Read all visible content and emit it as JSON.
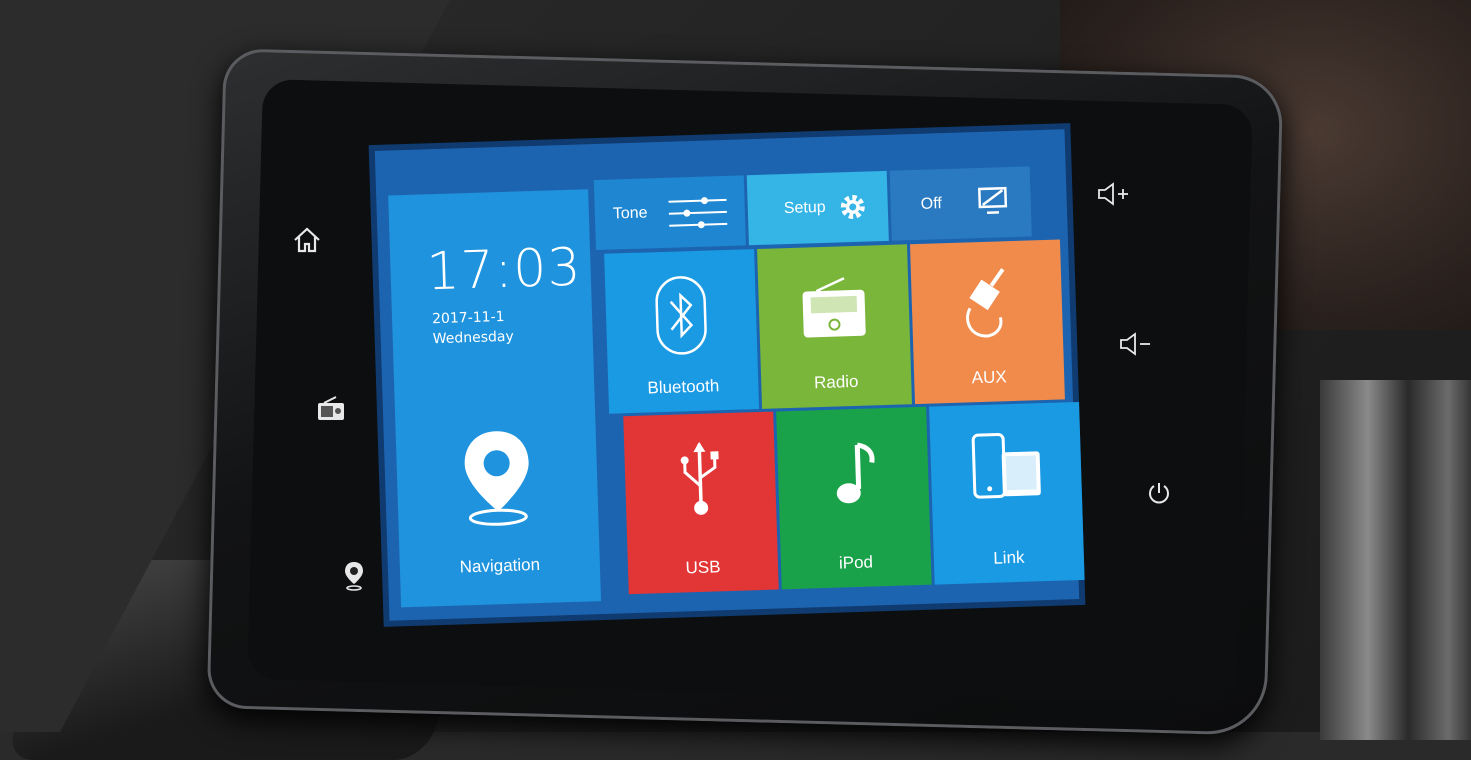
{
  "screen": {
    "clock": "17:03",
    "date": "2017-11-1",
    "weekday": "Wednesday",
    "tiles": {
      "navigation": "Navigation",
      "tone": "Tone",
      "setup": "Setup",
      "off": "Off",
      "bluetooth": "Bluetooth",
      "radio": "Radio",
      "aux": "AUX",
      "usb": "USB",
      "ipod": "iPod",
      "link": "Link"
    }
  },
  "hardware_buttons": {
    "left": [
      "home-icon",
      "radio-icon",
      "navigation-pin-icon"
    ],
    "right": [
      "volume-up-icon",
      "volume-down-icon",
      "power-icon"
    ]
  },
  "colors": {
    "navigation": "#1f93dd",
    "bluetooth": "#1b9ae4",
    "radio": "#79b63a",
    "aux": "#f08b4c",
    "usb": "#e23536",
    "ipod": "#1aa24b",
    "link": "#1b9ae4",
    "setup": "#35b4e6"
  }
}
